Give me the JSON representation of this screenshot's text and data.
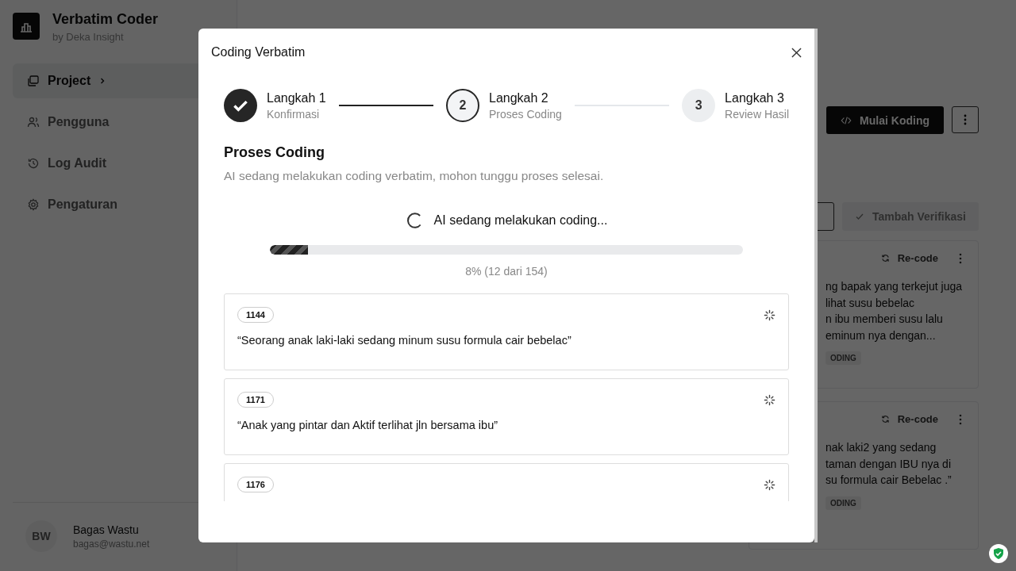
{
  "sidebar": {
    "app_title": "Verbatim Coder",
    "app_subtitle": "by Deka Insight",
    "items": [
      {
        "label": "Project",
        "selected": true
      },
      {
        "label": "Pengguna",
        "selected": false
      },
      {
        "label": "Log Audit",
        "selected": false
      },
      {
        "label": "Pengaturan",
        "selected": false
      }
    ],
    "user": {
      "initials": "BW",
      "name": "Bagas Wastu",
      "email": "bagas@wastu.net"
    }
  },
  "main": {
    "primary_button": "Mulai Koding",
    "verify_button": {
      "label": "Tambah Verifikasi",
      "disabled": true
    },
    "cards": [
      {
        "action": "Re-code",
        "lines": [
          "ng bapak yang terkejut juga",
          "lihat susu bebelac",
          "n ibu memberi susu lalu",
          "eminum nya dengan..."
        ],
        "badge": "ODING"
      },
      {
        "action": "Re-code",
        "lines": [
          "nak laki2 yang sedang",
          "taman dengan IBU nya di",
          "su formula cair Bebelac .”"
        ],
        "badge": "ODING"
      }
    ]
  },
  "modal": {
    "title": "Coding Verbatim",
    "steps": [
      {
        "title": "Langkah 1",
        "subtitle": "Konfirmasi",
        "completed": true,
        "selected": false
      },
      {
        "number": "2",
        "title": "Langkah 2",
        "subtitle": "Proses Coding",
        "completed": false,
        "selected": true
      },
      {
        "number": "3",
        "title": "Langkah 3",
        "subtitle": "Review Hasil",
        "completed": false,
        "selected": false
      }
    ],
    "heading": "Proses Coding",
    "description": "AI sedang melakukan coding verbatim, mohon tunggu proses selesai.",
    "status_text": "AI sedang melakukan coding...",
    "progress": {
      "level": 0.08,
      "reading": "8% (12 dari 154)"
    },
    "items": [
      {
        "id": "1144",
        "text": "“Seorang anak laki-laki sedang minum susu formula cair bebelac”"
      },
      {
        "id": "1171",
        "text": "“Anak yang pintar dan Aktif terlihat jln bersama ibu”"
      },
      {
        "id": "1176"
      }
    ]
  }
}
